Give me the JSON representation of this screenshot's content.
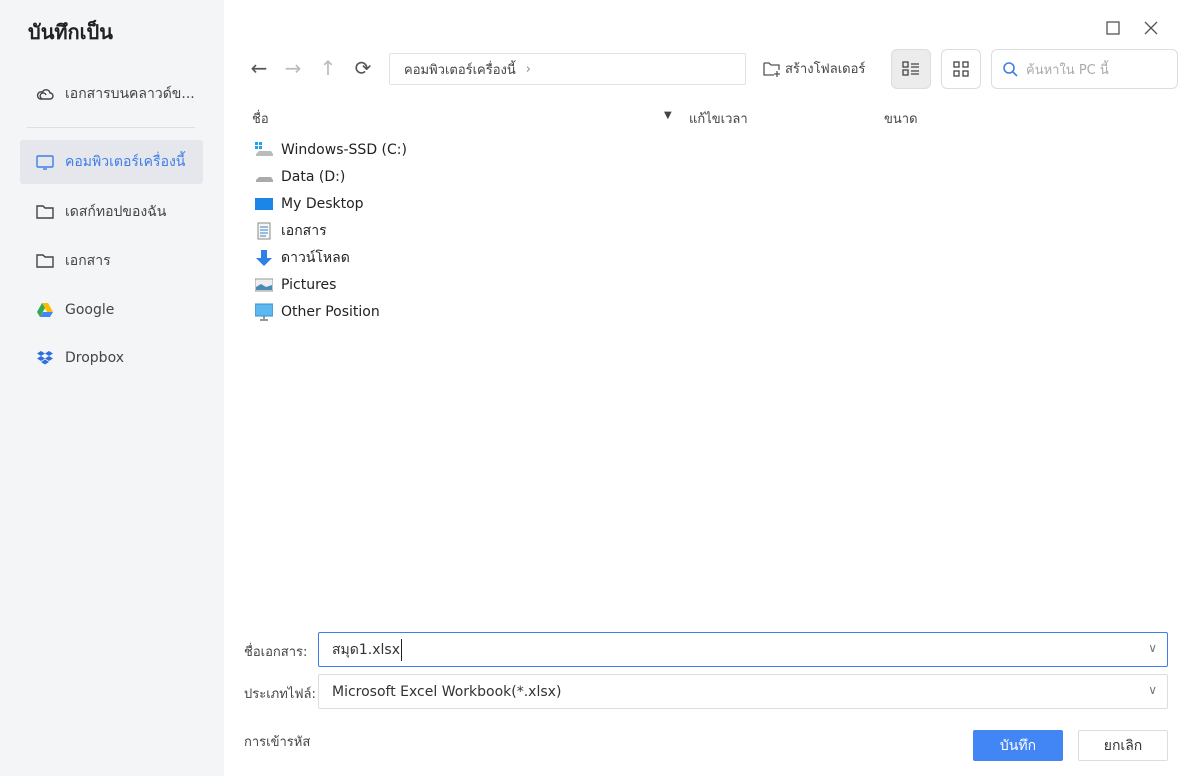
{
  "dialog": {
    "title": "บันทึกเป็น"
  },
  "sidebar": {
    "items": [
      {
        "label": "เอกสารบนคลาวด์ข...",
        "icon": "cloud-icon"
      },
      {
        "label": "คอมพิวเตอร์เครื่องนี้",
        "icon": "monitor-icon",
        "selected": true
      },
      {
        "label": "เดสก์ทอปของฉัน",
        "icon": "folder-icon"
      },
      {
        "label": "เอกสาร",
        "icon": "folder-icon"
      },
      {
        "label": "Google",
        "icon": "google-drive-icon"
      },
      {
        "label": "Dropbox",
        "icon": "dropbox-icon"
      }
    ]
  },
  "toolbar": {
    "breadcrumb": "คอมพิวเตอร์เครื่องนี้",
    "new_folder": "สร้างโฟลเดอร์",
    "search_placeholder": "ค้นหาใน PC นี้"
  },
  "columns": {
    "name": "ชื่อ",
    "modified": "แก้ไขเวลา",
    "size": "ขนาด"
  },
  "files": [
    {
      "name": "Windows-SSD (C:)",
      "icon": "windows-drive-icon"
    },
    {
      "name": "Data (D:)",
      "icon": "drive-icon"
    },
    {
      "name": "My Desktop",
      "icon": "desktop-icon"
    },
    {
      "name": "เอกสาร",
      "icon": "document-icon"
    },
    {
      "name": "ดาวน์โหลด",
      "icon": "download-icon"
    },
    {
      "name": "Pictures",
      "icon": "pictures-icon"
    },
    {
      "name": "Other Position",
      "icon": "computer-icon"
    }
  ],
  "form": {
    "filename_label": "ชื่อเอกสาร:",
    "filename_value": "สมุด1.xlsx",
    "filetype_label": "ประเภทไฟล์:",
    "filetype_value": "Microsoft Excel Workbook(*.xlsx)",
    "encoding_label": "การเข้ารหัส"
  },
  "buttons": {
    "save": "บันทึก",
    "cancel": "ยกเลิก"
  },
  "colors": {
    "accent": "#4285f4",
    "selected_text": "#3f7ee8"
  }
}
